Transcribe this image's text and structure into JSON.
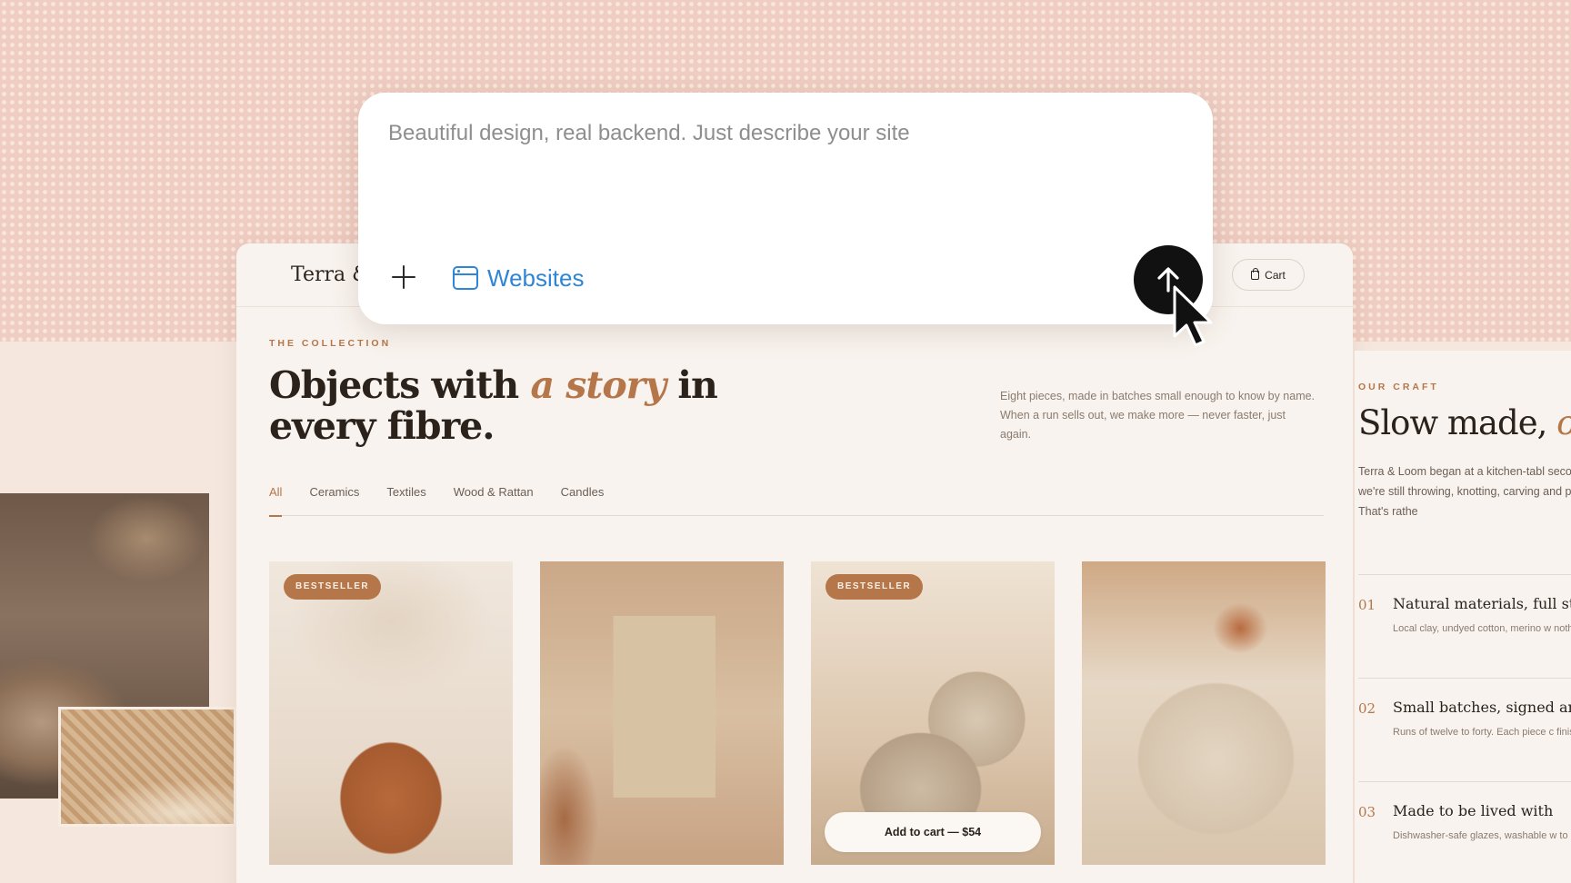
{
  "prompt": {
    "placeholder": "Beautiful design, real backend. Just describe your site",
    "mode_label": "Websites"
  },
  "site": {
    "brand": "Terra &",
    "cart_label": "Cart",
    "eyebrow": "THE COLLECTION",
    "headline_pre": "Objects with ",
    "headline_em": "a story",
    "headline_post": " in every fibre.",
    "intro": "Eight pieces, made in batches small enough to know by name. When a run sells out, we make more — never faster, just again.",
    "tabs": [
      "All",
      "Ceramics",
      "Textiles",
      "Wood & Rattan",
      "Candles"
    ],
    "products": [
      {
        "badge": "BESTSELLER"
      },
      {
        "badge": ""
      },
      {
        "badge": "BESTSELLER",
        "cta": "Add to cart — $54"
      },
      {
        "badge": ""
      }
    ]
  },
  "craft": {
    "eyebrow": "OUR CRAFT",
    "title_pre": "Slow made, ",
    "title_em": "o",
    "body": "Terra & Loom began at a kitchen-tabl secondhand loom. Five years on, we're still throwing, knotting, carving and p Slower than a factory, yes. That's rathe",
    "items": [
      {
        "num": "01",
        "title": "Natural materials, full st",
        "desc": "Local clay, undyed cotton, merino w nothing we can't pronounce."
      },
      {
        "num": "02",
        "title": "Small batches, signed an",
        "desc": "Runs of twelve to forty. Each piece c finished."
      },
      {
        "num": "03",
        "title": "Made to be lived with",
        "desc": "Dishwasher-safe glazes, washable w to be tiptoed around."
      }
    ]
  },
  "colors": {
    "accent": "#b5764a",
    "link_blue": "#2f85d6",
    "send_button": "#111111",
    "background_pink": "#efcdc2"
  }
}
